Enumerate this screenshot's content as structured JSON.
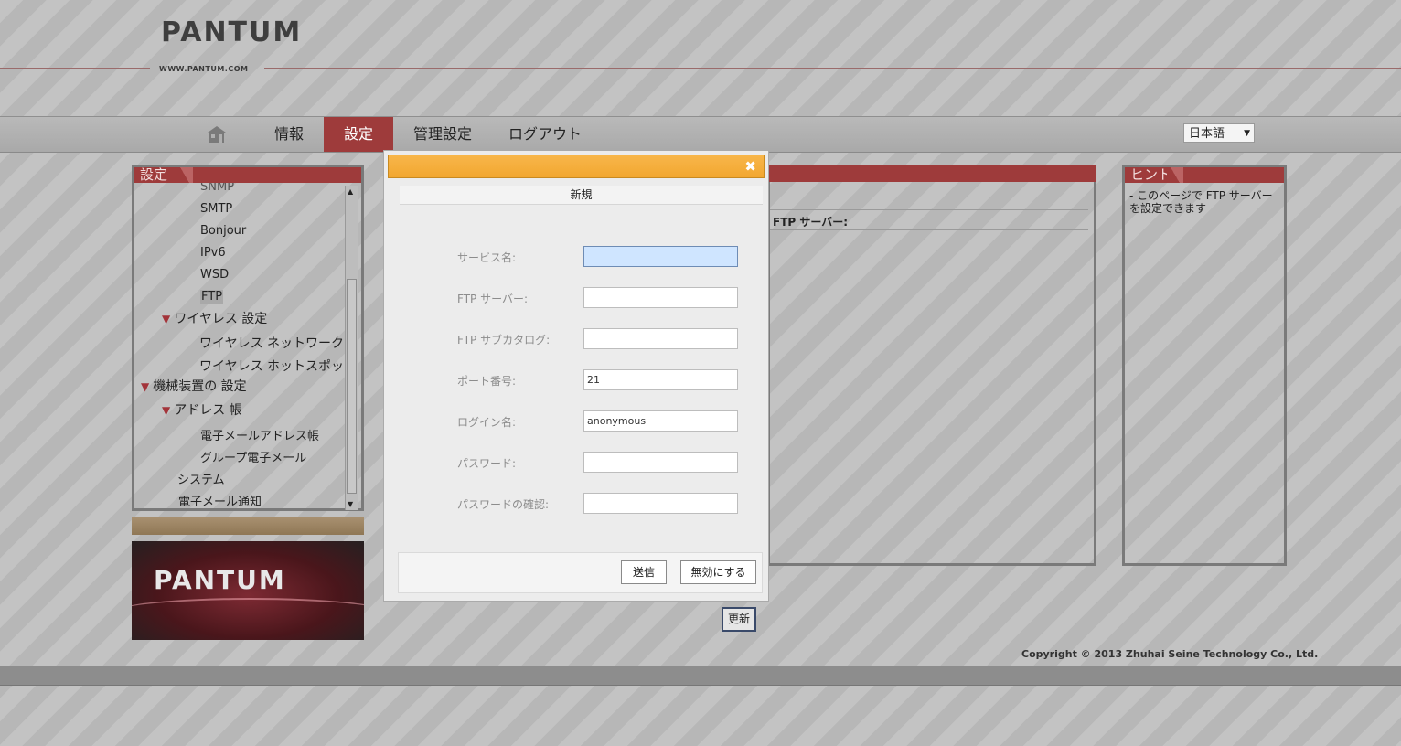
{
  "header": {
    "logo": "PANTUM",
    "url": "WWW.PANTUM.COM"
  },
  "nav": {
    "home_icon": "home-icon",
    "items": [
      "情報",
      "設定",
      "管理設定",
      "ログアウト"
    ],
    "active": "設定",
    "language": "日本語"
  },
  "sidebar": {
    "title": "設定",
    "items": [
      "SNMP",
      "SMTP",
      "Bonjour",
      "IPv6",
      "WSD",
      "FTP",
      "ワイヤレス 設定",
      "ワイヤレス ネットワーク",
      "ワイヤレス ホットスポット",
      "機械装置の 設定",
      "アドレス 帳",
      "電子メールアドレス帳",
      "グループ電子メール",
      "システム",
      "電子メール通知"
    ],
    "selected": "FTP"
  },
  "banner": {
    "logo": "PANTUM"
  },
  "main": {
    "ftp_server_label": "FTP サーバー:",
    "refresh_label": "更新"
  },
  "hint": {
    "title": "ヒント",
    "text": "- このページで FTP サーバーを設定できます"
  },
  "footer": {
    "copyright": "Copyright © 2013 Zhuhai Seine Technology Co., Ltd."
  },
  "modal": {
    "close_icon": "close-icon",
    "subtitle": "新規",
    "fields": [
      {
        "label": "サービス名:",
        "value": ""
      },
      {
        "label": "FTP サーバー:",
        "value": ""
      },
      {
        "label": "FTP サブカタログ:",
        "value": ""
      },
      {
        "label": "ポート番号:",
        "value": "21"
      },
      {
        "label": "ログイン名:",
        "value": "anonymous"
      },
      {
        "label": "パスワード:",
        "value": ""
      },
      {
        "label": "パスワードの確認:",
        "value": ""
      }
    ],
    "submit_label": "送信",
    "cancel_label": "無効にする"
  }
}
